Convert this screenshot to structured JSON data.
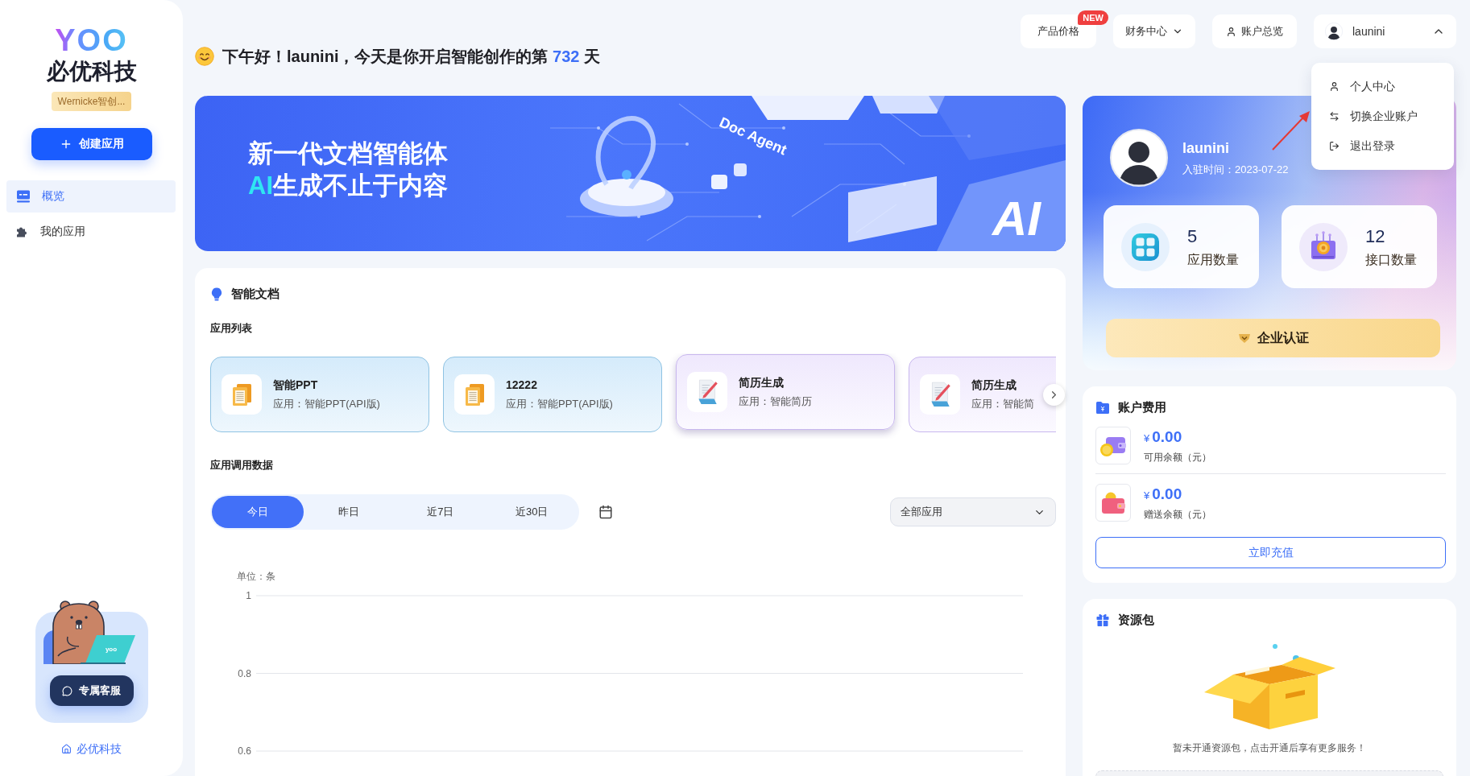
{
  "sidebar": {
    "logo": "YOO",
    "brand": "必优科技",
    "workspace": "Wernicke智创...",
    "create_button": "创建应用",
    "nav": [
      {
        "kind": "overview",
        "label": "概览",
        "selected": true
      },
      {
        "kind": "apps",
        "label": "我的应用",
        "selected": false
      }
    ],
    "support": {
      "laptop_logo": "yoo",
      "button": "专属客服"
    },
    "home_link": "必优科技"
  },
  "header": {
    "greeting": {
      "prefix": "下午好！launini，今天是你开启智能创作的第",
      "days": "732",
      "suffix": "天"
    },
    "nav": [
      {
        "kind": "badge_button",
        "label": "产品价格",
        "badge": "NEW"
      },
      {
        "kind": "menu",
        "label": "财务中心",
        "expanded": false
      },
      {
        "kind": "icon_button",
        "label": "账户总览"
      },
      {
        "kind": "user",
        "label": "launini",
        "expanded": true
      }
    ],
    "user_menu": [
      {
        "kind": "profile",
        "label": "个人中心"
      },
      {
        "kind": "switch",
        "label": "切换企业账户"
      },
      {
        "kind": "logout",
        "label": "退出登录"
      }
    ]
  },
  "banner": {
    "title": "新一代文档智能体",
    "highlight": "AI",
    "subtitle": "生成不止于内容",
    "tag": "Doc Agent",
    "corner_text": "AI"
  },
  "smart_docs": {
    "title": "智能文档",
    "list_title": "应用列表",
    "apps": [
      {
        "kind": "ppt",
        "name": "智能PPT",
        "app": "应用：智能PPT(API版)",
        "highlighted": false
      },
      {
        "kind": "ppt",
        "name": "12222",
        "app": "应用：智能PPT(API版)",
        "highlighted": false
      },
      {
        "kind": "resume",
        "name": "简历生成",
        "app": "应用：智能简历",
        "highlighted": true
      },
      {
        "kind": "resume",
        "name": "简历生成",
        "app": "应用：智能简",
        "highlighted": false
      }
    ],
    "usage_title": "应用调用数据",
    "ranges": [
      {
        "label": "今日",
        "selected": true
      },
      {
        "label": "昨日",
        "selected": false
      },
      {
        "label": "近7日",
        "selected": false
      },
      {
        "label": "近30日",
        "selected": false
      }
    ],
    "app_filter": "全部应用",
    "usage_chart": {
      "unit": "单位：条",
      "y_labels": [
        "1",
        "0.8",
        "0.6"
      ]
    }
  },
  "profile": {
    "name": "launini",
    "joined": "入驻时间：2023-07-22",
    "stats": [
      {
        "kind": "apps",
        "value": "5",
        "label": "应用数量"
      },
      {
        "kind": "api",
        "value": "12",
        "label": "接口数量"
      }
    ],
    "verify_button": "企业认证"
  },
  "account_fees": {
    "title": "账户费用",
    "balances": [
      {
        "kind": "available",
        "currency": "¥",
        "amount": "0.00",
        "label": "可用余额（元）"
      },
      {
        "kind": "gift",
        "currency": "¥",
        "amount": "0.00",
        "label": "赠送余额（元）"
      }
    ],
    "recharge_button": "立即充值"
  },
  "resource_pack": {
    "title": "资源包",
    "empty_text": "暂未开通资源包，点击开通后享有更多服务！"
  }
}
